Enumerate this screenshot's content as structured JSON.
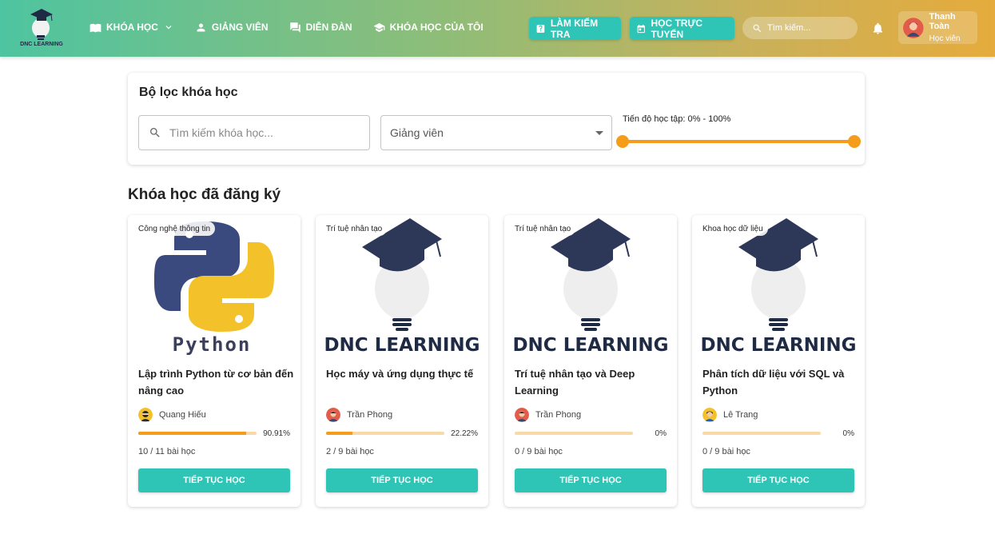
{
  "header": {
    "logo_text": "DNC LEARNING",
    "nav": [
      {
        "label": "KHÓA HỌC",
        "icon": "book-icon"
      },
      {
        "label": "GIẢNG VIÊN",
        "icon": "person-icon"
      },
      {
        "label": "DIỄN ĐÀN",
        "icon": "forum-icon"
      },
      {
        "label": "KHÓA HỌC CỦA TÔI",
        "icon": "school-icon"
      }
    ],
    "quiz_button": "LÀM KIỂM TRA",
    "online_button": "HỌC TRỰC TUYẾN",
    "search_placeholder": "Tìm kiếm...",
    "user": {
      "name": "Thanh Toàn",
      "role": "Học viên"
    }
  },
  "filter": {
    "title": "Bộ lọc khóa học",
    "search_placeholder": "Tìm kiếm khóa học...",
    "instructor_select": "Giảng viên",
    "progress_label": "Tiến độ học tập: 0% - 100%",
    "progress_min": 0,
    "progress_max": 100
  },
  "section_title": "Khóa học đã đăng ký",
  "courses": [
    {
      "category": "Công nghệ thông tin",
      "image_text": "Python",
      "title": "Lập trình Python từ cơ bản đến nâng cao",
      "instructor": "Quang Hiếu",
      "progress_pct": "90.91%",
      "progress": 90.91,
      "lessons": "10 / 11 bài học",
      "button": "TIẾP TỤC HỌC"
    },
    {
      "category": "Trí tuệ nhân tạo",
      "image_text": "DNC LEARNING",
      "title": "Học máy và ứng dụng thực tế",
      "instructor": "Trần Phong",
      "progress_pct": "22.22%",
      "progress": 22.22,
      "lessons": "2 / 9 bài học",
      "button": "TIẾP TỤC HỌC"
    },
    {
      "category": "Trí tuệ nhân tạo",
      "image_text": "DNC LEARNING",
      "title": "Trí tuệ nhân tạo và Deep Learning",
      "instructor": "Trần Phong",
      "progress_pct": "0%",
      "progress": 0,
      "lessons": "0 / 9 bài học",
      "button": "TIẾP TỤC HỌC"
    },
    {
      "category": "Khoa học dữ liệu",
      "image_text": "DNC LEARNING",
      "title": "Phân tích dữ liệu với SQL và Python",
      "instructor": "Lê Trang",
      "progress_pct": "0%",
      "progress": 0,
      "lessons": "0 / 9 bài học",
      "button": "TIẾP TỤC HỌC"
    }
  ],
  "colors": {
    "accent": "#2ec4b6",
    "progress": "#f59c1a",
    "dark": "#1f2a44"
  }
}
